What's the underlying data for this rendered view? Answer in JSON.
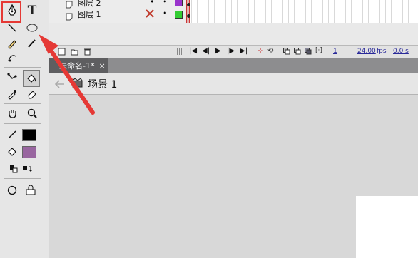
{
  "timeline": {
    "layers": [
      {
        "name": "图层 2",
        "color": "#9933cc"
      },
      {
        "name": "图层 1",
        "color": "#33cc33"
      }
    ],
    "frame_rate": "24.00",
    "frame_rate_unit": "fps",
    "current_frame": "1",
    "elapsed_time": "0.0 s"
  },
  "toolbar": {
    "text_tool_label": "T",
    "stroke_color": "#000000",
    "fill_color": "#9966a0"
  },
  "document": {
    "tab_title": "未命名-1*",
    "close_label": "×",
    "scene_name": "场景 1"
  },
  "annotation": {
    "highlight_color": "#e53935",
    "arrow_color": "#e53935"
  }
}
